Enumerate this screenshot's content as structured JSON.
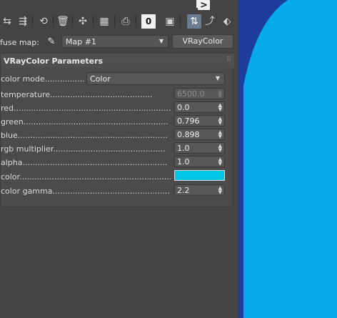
{
  "toolbar": {
    "icons": [
      "pick-material-icon",
      "assign-material-icon",
      "reset-map-icon",
      "delete-icon",
      "make-unique-icon",
      "put-to-library-icon",
      "material-id-channel-icon",
      "show-shaded-material-icon",
      "show-end-result-icon",
      "go-to-parent-icon",
      "go-forward-to-sibling-icon",
      "checker-background-icon"
    ],
    "material_id_digit": "0"
  },
  "map_row": {
    "label": "fuse map:",
    "map_value": "Map #1",
    "type_button": "VRayColor"
  },
  "rollout": {
    "title": "VRayColor Parameters",
    "color_mode": {
      "label": "color mode................",
      "value": "Color"
    },
    "params": [
      {
        "label": "temperature.........................................",
        "value": "6500.0",
        "enabled": false
      },
      {
        "label": "red...............................................................",
        "value": "0.0",
        "enabled": true
      },
      {
        "label": "green..........................................................",
        "value": "0.796",
        "enabled": true
      },
      {
        "label": "blue............................................................",
        "value": "0.898",
        "enabled": true
      },
      {
        "label": "rgb multiplier.............................................",
        "value": "1.0",
        "enabled": true
      },
      {
        "label": "alpha..........................................................",
        "value": "1.0",
        "enabled": true
      }
    ],
    "color": {
      "label": "color.............................................................",
      "swatch_hex": "#00c6e5"
    },
    "gamma": {
      "label": "color gamma................................................",
      "value": "2.2"
    }
  },
  "viewport": {
    "background_hex": "#07aae8",
    "shape_hex": "#1e3c9c"
  }
}
